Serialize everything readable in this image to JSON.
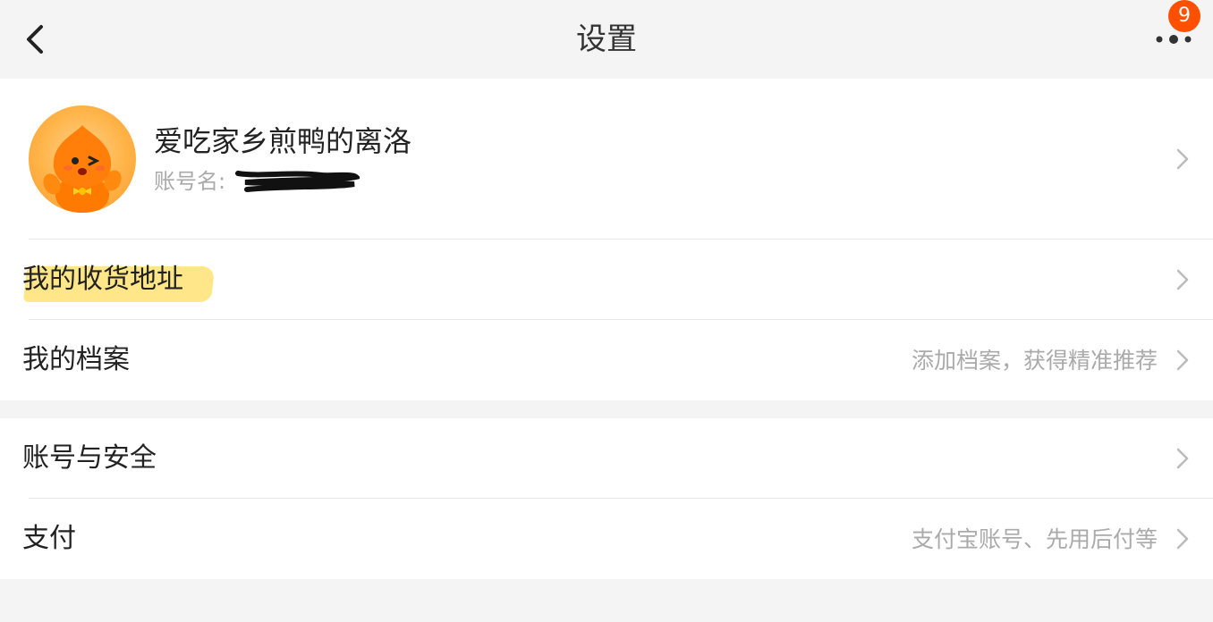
{
  "header": {
    "title": "设置",
    "back_icon": "chevron-left-icon",
    "more_icon": "more-dots-icon",
    "badge_count": "9",
    "badge_color": "#ff5000"
  },
  "profile": {
    "nickname": "爱吃家乡煎鸭的离洛",
    "account_label": "账号名:",
    "account_value_redacted": true,
    "avatar_icon": "mascot-avatar"
  },
  "section1": [
    {
      "label": "我的收货地址",
      "hint": "",
      "highlighted": true
    },
    {
      "label": "我的档案",
      "hint": "添加档案，获得精准推荐"
    }
  ],
  "section2": [
    {
      "label": "账号与安全",
      "hint": ""
    },
    {
      "label": "支付",
      "hint": "支付宝账号、先用后付等"
    }
  ],
  "colors": {
    "accent": "#ff5000",
    "highlight": "#ffe273",
    "background": "#f4f4f4",
    "hint_text": "#aaaaaa"
  }
}
